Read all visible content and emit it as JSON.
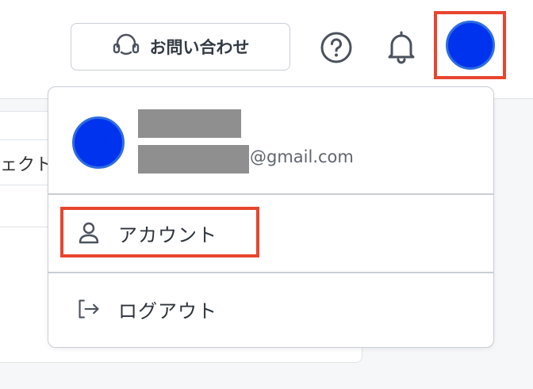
{
  "header": {
    "contact_label": "お問い合わせ",
    "help_icon": "question-circle-icon",
    "notification_icon": "bell-icon",
    "avatar_color": "#0033ee",
    "highlight_color": "#e8452e"
  },
  "background": {
    "tab_label": "ェクト"
  },
  "user_menu": {
    "email_domain": "@gmail.com",
    "items": [
      {
        "label": "アカウント",
        "icon": "user-icon"
      },
      {
        "label": "ログアウト",
        "icon": "logout-icon"
      }
    ]
  }
}
